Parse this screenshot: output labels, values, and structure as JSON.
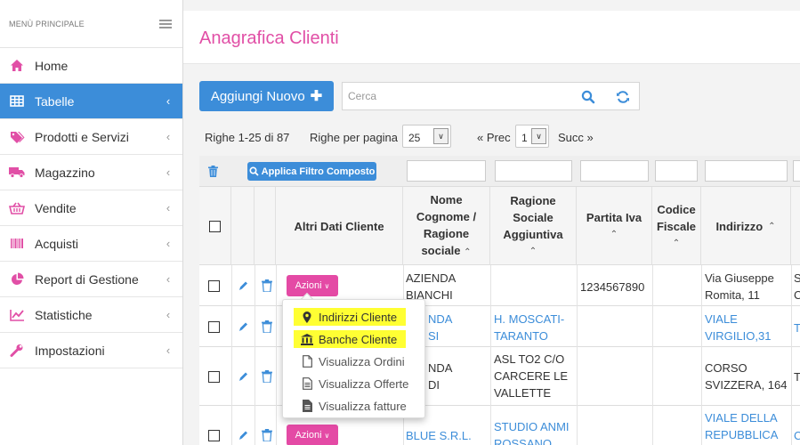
{
  "sidebar": {
    "header": "MENÙ PRINCIPALE",
    "items": [
      {
        "label": "Home",
        "icon": "home-icon"
      },
      {
        "label": "Tabelle",
        "icon": "table-icon"
      },
      {
        "label": "Prodotti e Servizi",
        "icon": "tags-icon"
      },
      {
        "label": "Magazzino",
        "icon": "truck-icon"
      },
      {
        "label": "Vendite",
        "icon": "basket-icon"
      },
      {
        "label": "Acquisti",
        "icon": "barcode-icon"
      },
      {
        "label": "Report di Gestione",
        "icon": "pie-chart-icon"
      },
      {
        "label": "Statistiche",
        "icon": "line-chart-icon"
      },
      {
        "label": "Impostazioni",
        "icon": "wrench-icon"
      }
    ]
  },
  "colors": {
    "accent": "#3c8dd9",
    "title": "#e14fa6",
    "action": "#e44aa5",
    "highlight": "#ffff33"
  },
  "page_title": "Anagrafica Clienti",
  "toolbar": {
    "add_label": "Aggiungi Nuovo",
    "search_placeholder": "Cerca"
  },
  "pager": {
    "range_text": "Righe 1-25 di 87",
    "per_page_label": "Righe per pagina",
    "per_page_value": "25",
    "prev_label": "« Prec",
    "page_value": "1",
    "next_label": "Succ »"
  },
  "table": {
    "filter_button": "Applica Filtro Composto",
    "headers": {
      "altri": "Altri Dati Cliente",
      "nome": [
        "Nome",
        "Cognome /",
        "Ragione",
        "sociale"
      ],
      "ragione_agg": [
        "Ragione",
        "Sociale",
        "Aggiuntiva"
      ],
      "piva": "Partita Iva",
      "cf": [
        "Codice",
        "Fiscale"
      ],
      "indirizzo": "Indirizzo"
    },
    "action_label": "Azioni",
    "rows": [
      {
        "nome": [
          "AZIENDA",
          "BIANCHI"
        ],
        "ragione": [],
        "piva": "1234567890",
        "indirizzo": [
          "Via Giuseppe",
          "Romita, 11"
        ],
        "extra": [
          "Sa",
          "Co"
        ]
      },
      {
        "nome": [
          "NDA",
          "SI"
        ],
        "ragione": [
          "H. MOSCATI-",
          "TARANTO"
        ],
        "piva": "",
        "indirizzo": [
          "VIALE",
          "VIRGILIO,31"
        ],
        "extra": [
          "TA"
        ]
      },
      {
        "nome": [
          "NDA",
          "DI"
        ],
        "ragione": [
          "ASL TO2 C/O",
          "CARCERE LE",
          "VALLETTE"
        ],
        "piva": "",
        "indirizzo": [
          "CORSO",
          "SVIZZERA, 164"
        ],
        "extra": [
          "TO"
        ]
      },
      {
        "nome": [
          "BLUE S.R.L."
        ],
        "ragione": [
          "STUDIO ANMI",
          "ROSSANO"
        ],
        "piva": "",
        "indirizzo": [
          "VIALE DELLA",
          "REPUBBLICA"
        ],
        "extra": [
          "CC"
        ]
      }
    ]
  },
  "dropdown": {
    "items": [
      {
        "label": "Indirizzi Cliente",
        "icon": "map-marker-icon",
        "highlighted": true
      },
      {
        "label": "Banche Cliente",
        "icon": "bank-icon",
        "highlighted": true
      },
      {
        "label": "Visualizza Ordini",
        "icon": "file-outline-icon",
        "highlighted": false
      },
      {
        "label": "Visualizza Offerte",
        "icon": "file-text-outline-icon",
        "highlighted": false
      },
      {
        "label": "Visualizza fatture",
        "icon": "file-text-icon",
        "highlighted": false
      }
    ]
  }
}
